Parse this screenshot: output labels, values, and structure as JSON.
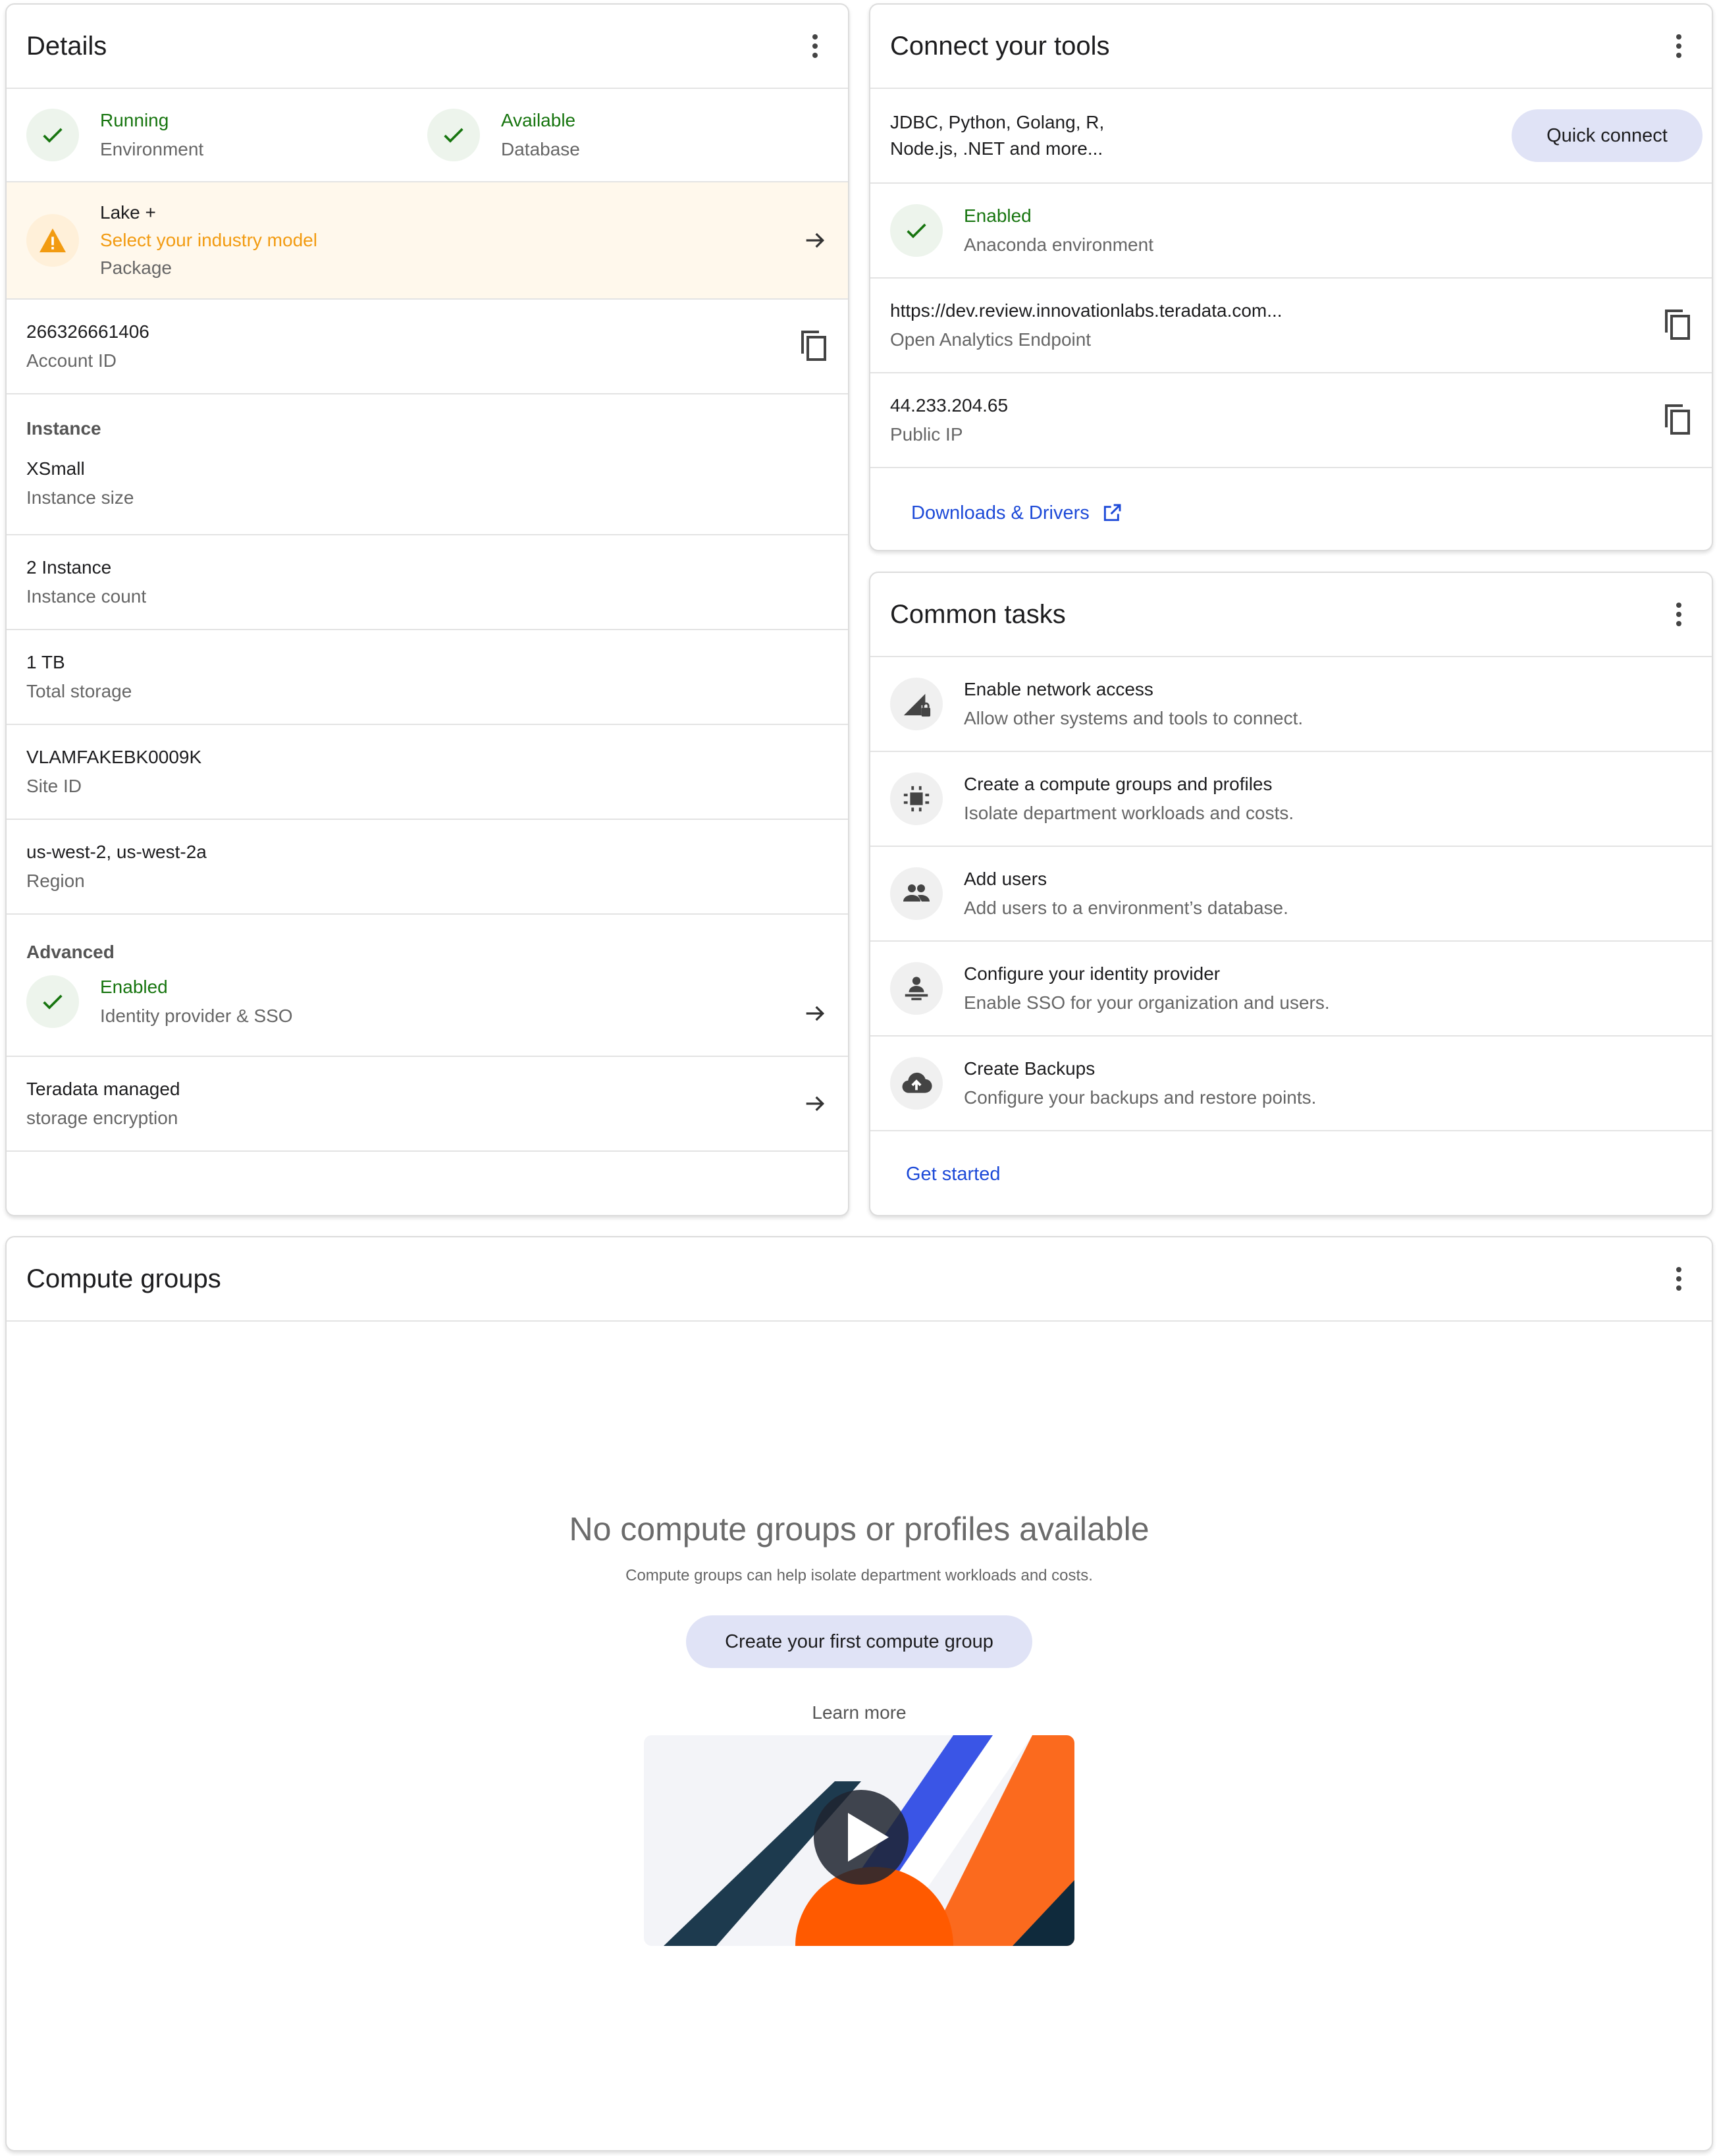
{
  "details": {
    "title": "Details",
    "status": [
      {
        "value": "Running",
        "label": "Environment"
      },
      {
        "value": "Available",
        "label": "Database"
      }
    ],
    "package": {
      "name": "Lake +",
      "action": "Select your industry model",
      "label": "Package"
    },
    "account": {
      "value": "266326661406",
      "label": "Account ID"
    },
    "instance_heading": "Instance",
    "instance_size": {
      "value": "XSmall",
      "label": "Instance size"
    },
    "instance_count": {
      "value": "2 Instance",
      "label": "Instance count"
    },
    "storage": {
      "value": "1 TB",
      "label": "Total storage"
    },
    "site": {
      "value": "VLAMFAKEBK0009K",
      "label": "Site ID"
    },
    "region": {
      "value": "us-west-2, us-west-2a",
      "label": "Region"
    },
    "advanced_heading": "Advanced",
    "sso": {
      "value": "Enabled",
      "label": "Identity provider & SSO"
    },
    "encryption": {
      "value": "Teradata managed",
      "label": "storage encryption"
    }
  },
  "connect": {
    "title": "Connect your tools",
    "languages_line1": "JDBC, Python, Golang, R,",
    "languages_line2": "Node.js, .NET and more...",
    "quick_connect": "Quick connect",
    "anaconda": {
      "value": "Enabled",
      "label": "Anaconda environment"
    },
    "endpoint": {
      "value": "https://dev.review.innovationlabs.teradata.com...",
      "label": "Open Analytics Endpoint"
    },
    "public_ip": {
      "value": "44.233.204.65",
      "label": "Public IP"
    },
    "downloads": "Downloads & Drivers"
  },
  "tasks": {
    "title": "Common tasks",
    "items": [
      {
        "title": "Enable network access",
        "desc": "Allow other systems and tools to connect.",
        "icon": "network-lock-icon"
      },
      {
        "title": "Create a compute groups and profiles",
        "desc": "Isolate department workloads and costs.",
        "icon": "compute-chip-icon"
      },
      {
        "title": "Add users",
        "desc": "Add users to a environment’s database.",
        "icon": "users-icon"
      },
      {
        "title": "Configure your identity provider",
        "desc": "Enable SSO for your organization and users.",
        "icon": "identity-person-icon"
      },
      {
        "title": "Create Backups",
        "desc": "Configure your backups and restore points.",
        "icon": "cloud-upload-icon"
      }
    ],
    "get_started": "Get started"
  },
  "compute": {
    "title": "Compute groups",
    "empty_title": "No compute groups or profiles available",
    "empty_sub": "Compute groups can help isolate department workloads and costs.",
    "create_button": "Create your first compute group",
    "learn_more": "Learn more"
  },
  "colors": {
    "success": "#17750f",
    "warning": "#f29b11",
    "link": "#1d4ad8",
    "button_bg": "#e0e3f6",
    "warning_bg": "#fff8ec"
  }
}
